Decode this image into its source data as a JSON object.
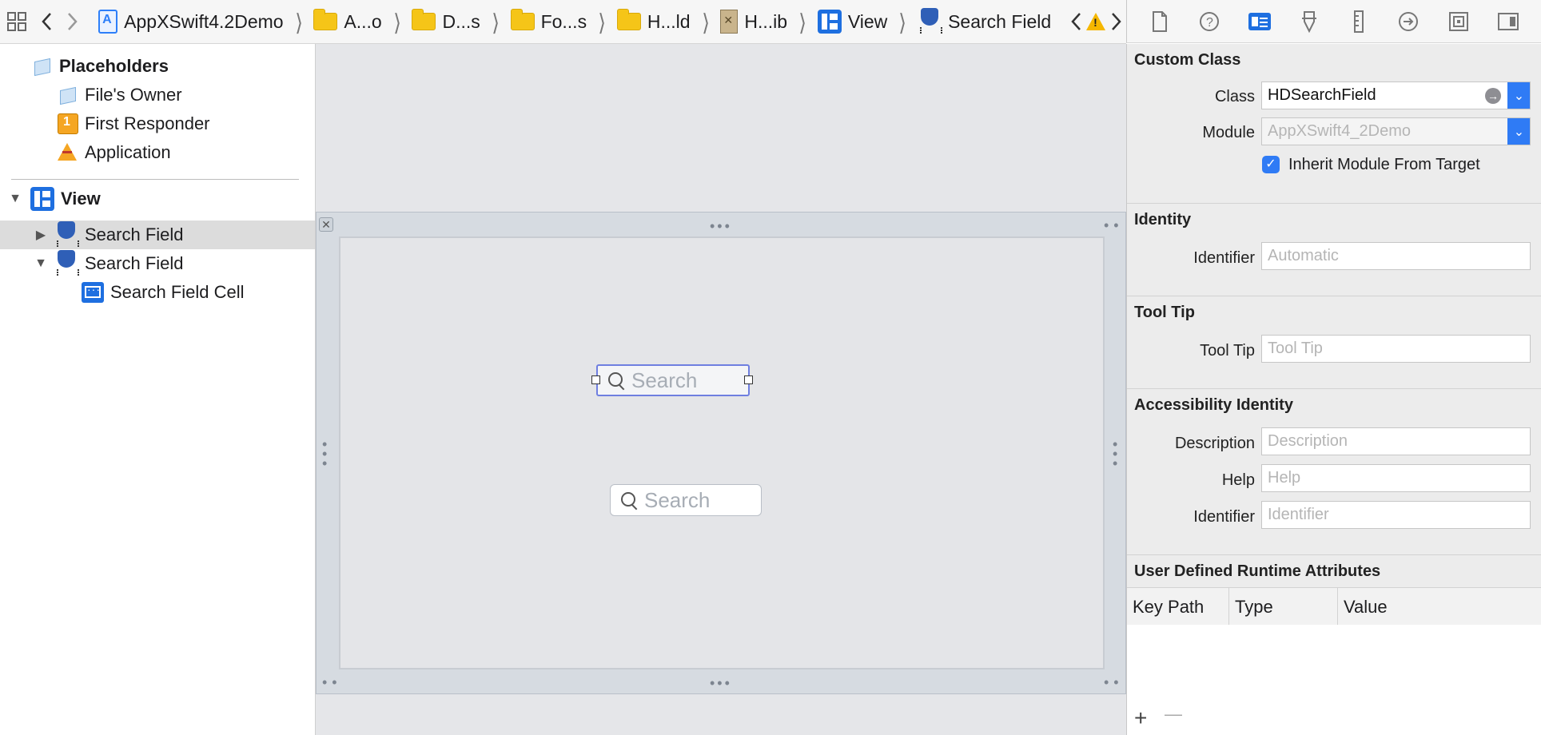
{
  "jumpbar": {
    "crumbs": [
      {
        "label": "AppXSwift4.2Demo",
        "icon": "project-icon"
      },
      {
        "label": "A...o",
        "icon": "folder-icon"
      },
      {
        "label": "D...s",
        "icon": "folder-icon"
      },
      {
        "label": "Fo...s",
        "icon": "folder-icon"
      },
      {
        "label": "H...ld",
        "icon": "folder-icon"
      },
      {
        "label": "H...ib",
        "icon": "xib-file-icon"
      },
      {
        "label": "View",
        "icon": "view-icon"
      },
      {
        "label": "Search Field",
        "icon": "search-field-icon"
      }
    ]
  },
  "outline": {
    "placeholders": "Placeholders",
    "files_owner": "File's Owner",
    "first_responder": "First Responder",
    "application": "Application",
    "view": "View",
    "search_field_1": "Search Field",
    "search_field_2": "Search Field",
    "search_field_cell": "Search Field Cell"
  },
  "canvas": {
    "search1_placeholder": "Search",
    "search2_placeholder": "Search"
  },
  "inspector": {
    "custom_class": {
      "title": "Custom Class",
      "class_label": "Class",
      "class_value": "HDSearchField",
      "module_label": "Module",
      "module_placeholder": "AppXSwift4_2Demo",
      "inherit_label": "Inherit Module From Target",
      "inherit_checked": true
    },
    "identity": {
      "title": "Identity",
      "identifier_label": "Identifier",
      "identifier_placeholder": "Automatic"
    },
    "tooltip": {
      "title": "Tool Tip",
      "label": "Tool Tip",
      "placeholder": "Tool Tip"
    },
    "accessibility": {
      "title": "Accessibility Identity",
      "description_label": "Description",
      "description_placeholder": "Description",
      "help_label": "Help",
      "help_placeholder": "Help",
      "identifier_label": "Identifier",
      "identifier_placeholder": "Identifier"
    },
    "runtime_attrs": {
      "title": "User Defined Runtime Attributes",
      "columns": [
        "Key Path",
        "Type",
        "Value"
      ],
      "add": "+",
      "remove": "—"
    }
  },
  "colors": {
    "accent": "#2f7bf5",
    "selection_row": "#dcdcdc",
    "canvas_bg": "#e5e6e9"
  }
}
